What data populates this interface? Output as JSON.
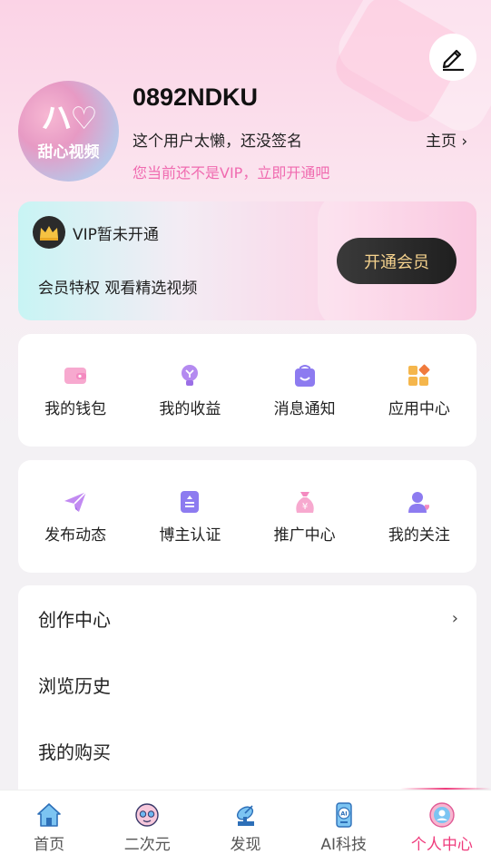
{
  "profile": {
    "username": "0892NDKU",
    "signature": "这个用户太懒，还没签名",
    "home_link": "主页 ›",
    "vip_hint": "您当前还不是VIP，立即开通吧",
    "avatar_mark": "ハ♡",
    "avatar_text": "甜心视频"
  },
  "vip": {
    "status": "VIP暂未开通",
    "description": "会员特权 观看精选视频",
    "button": "开通会员"
  },
  "grid1": [
    {
      "label": "我的钱包",
      "icon": "wallet-icon"
    },
    {
      "label": "我的收益",
      "icon": "earnings-icon"
    },
    {
      "label": "消息通知",
      "icon": "message-icon"
    },
    {
      "label": "应用中心",
      "icon": "apps-icon"
    }
  ],
  "grid2": [
    {
      "label": "发布动态",
      "icon": "send-icon"
    },
    {
      "label": "博主认证",
      "icon": "badge-icon"
    },
    {
      "label": "推广中心",
      "icon": "promo-icon"
    },
    {
      "label": "我的关注",
      "icon": "follow-icon"
    }
  ],
  "list": [
    {
      "label": "创作中心",
      "chevron": "›"
    },
    {
      "label": "浏览历史"
    },
    {
      "label": "我的购买"
    }
  ],
  "tabs": [
    {
      "label": "首页",
      "icon": "home-icon"
    },
    {
      "label": "二次元",
      "icon": "anime-icon"
    },
    {
      "label": "发现",
      "icon": "discover-icon"
    },
    {
      "label": "AI科技",
      "icon": "ai-icon"
    },
    {
      "label": "个人中心",
      "icon": "profile-icon",
      "active": true
    }
  ],
  "colors": {
    "accent": "#ef3b7c",
    "vip_hint": "#f06bb0",
    "vip_button_text": "#f6d38e"
  }
}
